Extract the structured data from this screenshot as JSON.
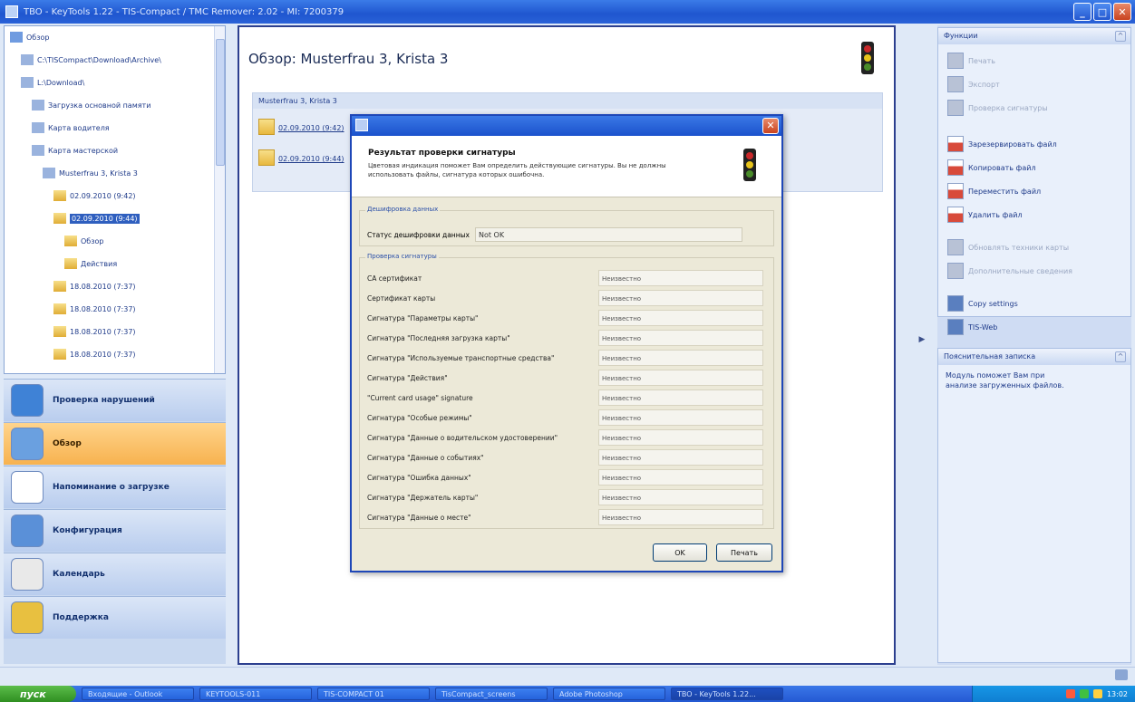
{
  "window": {
    "title": "TBO - KeyTools 1.22 - TIS-Compact / TMC Remover: 2.02 - MI: 7200379"
  },
  "tree": {
    "nodes": [
      {
        "label": "Обзор",
        "level": 0
      },
      {
        "label": "C:\\TISCompact\\Download\\Archive\\",
        "level": 1
      },
      {
        "label": "L:\\Download\\",
        "level": 1
      },
      {
        "label": "Загрузка основной памяти",
        "level": 2
      },
      {
        "label": "Карта водителя",
        "level": 2
      },
      {
        "label": "Карта мастерской",
        "level": 2
      },
      {
        "label": "Musterfrau 3, Krista 3",
        "level": 3
      },
      {
        "label": "02.09.2010 (9:42)",
        "level": 4
      },
      {
        "label": "02.09.2010 (9:44)",
        "level": 4,
        "selected": true
      },
      {
        "label": "Обзор",
        "level": 5
      },
      {
        "label": "Действия",
        "level": 5
      },
      {
        "label": "18.08.2010 (7:37)",
        "level": 4
      },
      {
        "label": "18.08.2010 (7:37)",
        "level": 4
      },
      {
        "label": "18.08.2010 (7:37)",
        "level": 4
      },
      {
        "label": "18.08.2010 (7:37)",
        "level": 4
      }
    ]
  },
  "nav": {
    "items": [
      {
        "label": "Проверка нарушений",
        "active": false
      },
      {
        "label": "Обзор",
        "active": true
      },
      {
        "label": "Напоминание о загрузке",
        "active": false
      },
      {
        "label": "Конфигурация",
        "active": false
      },
      {
        "label": "Календарь",
        "active": false
      },
      {
        "label": "Поддержка",
        "active": false
      }
    ]
  },
  "main": {
    "title": "Обзор: Musterfrau 3, Krista 3",
    "panel_header": "Musterfrau 3, Krista 3",
    "entries": [
      "02.09.2010 (9:42)",
      "02.09.2010 (9:44)"
    ]
  },
  "dialog": {
    "heading": "Результат проверки сигнатуры",
    "description": "Цветовая индикация поможет Вам определить действующие сигнатуры. Вы не должны использовать файлы, сигнатура которых ошибочна.",
    "decrypt_group": "Дешифровка данных",
    "decrypt_label": "Статус дешифровки данных",
    "decrypt_value": "Not OK",
    "check_group": "Проверка сигнатуры",
    "rows": [
      {
        "label": "CA сертификат",
        "value": "Неизвестно"
      },
      {
        "label": "Сертификат карты",
        "value": "Неизвестно"
      },
      {
        "label": "Сигнатура \"Параметры карты\"",
        "value": "Неизвестно"
      },
      {
        "label": "Сигнатура \"Последняя загрузка карты\"",
        "value": "Неизвестно"
      },
      {
        "label": "Сигнатура \"Используемые транспортные средства\"",
        "value": "Неизвестно"
      },
      {
        "label": "Сигнатура \"Действия\"",
        "value": "Неизвестно"
      },
      {
        "label": "\"Current card usage\" signature",
        "value": "Неизвестно"
      },
      {
        "label": "Сигнатура \"Особые режимы\"",
        "value": "Неизвестно"
      },
      {
        "label": "Сигнатура \"Данные о водительском удостоверении\"",
        "value": "Неизвестно"
      },
      {
        "label": "Сигнатура \"Данные о событиях\"",
        "value": "Неизвестно"
      },
      {
        "label": "Сигнатура \"Ошибка данных\"",
        "value": "Неизвестно"
      },
      {
        "label": "Сигнатура \"Держатель карты\"",
        "value": "Неизвестно"
      },
      {
        "label": "Сигнатура \"Данные о месте\"",
        "value": "Неизвестно"
      }
    ],
    "ok_label": "OK",
    "print_label": "Печать"
  },
  "functions": {
    "title": "Функции",
    "items": [
      {
        "label": "Печать",
        "enabled": false
      },
      {
        "label": "Экспорт",
        "enabled": false
      },
      {
        "label": "Проверка сигнатуры",
        "enabled": false
      },
      {
        "label": "Зарезервировать файл",
        "enabled": true
      },
      {
        "label": "Копировать файл",
        "enabled": true
      },
      {
        "label": "Переместить файл",
        "enabled": true
      },
      {
        "label": "Удалить файл",
        "enabled": true
      },
      {
        "label": "Обновлять техники карты",
        "enabled": false
      },
      {
        "label": "Дополнительные сведения",
        "enabled": false
      },
      {
        "label": "Copy settings",
        "enabled": true
      },
      {
        "label": "TIS-Web",
        "enabled": true
      }
    ]
  },
  "help": {
    "title": "Пояснительная записка",
    "text": "Модуль поможет Вам при анализе загруженных файлов."
  },
  "taskbar": {
    "start": "пуск",
    "tasks": [
      "Входящие - Outlook",
      "KEYTOOLS-011",
      "TIS-COMPACT 01",
      "TisCompact_screens",
      "Adobe Photoshop",
      "TBO - KeyTools 1.22..."
    ],
    "clock": "13:02"
  },
  "colors": {
    "accent": "#1f56cf",
    "nav_active": "#f7b24f",
    "dialog_bg": "#ece9d8"
  }
}
